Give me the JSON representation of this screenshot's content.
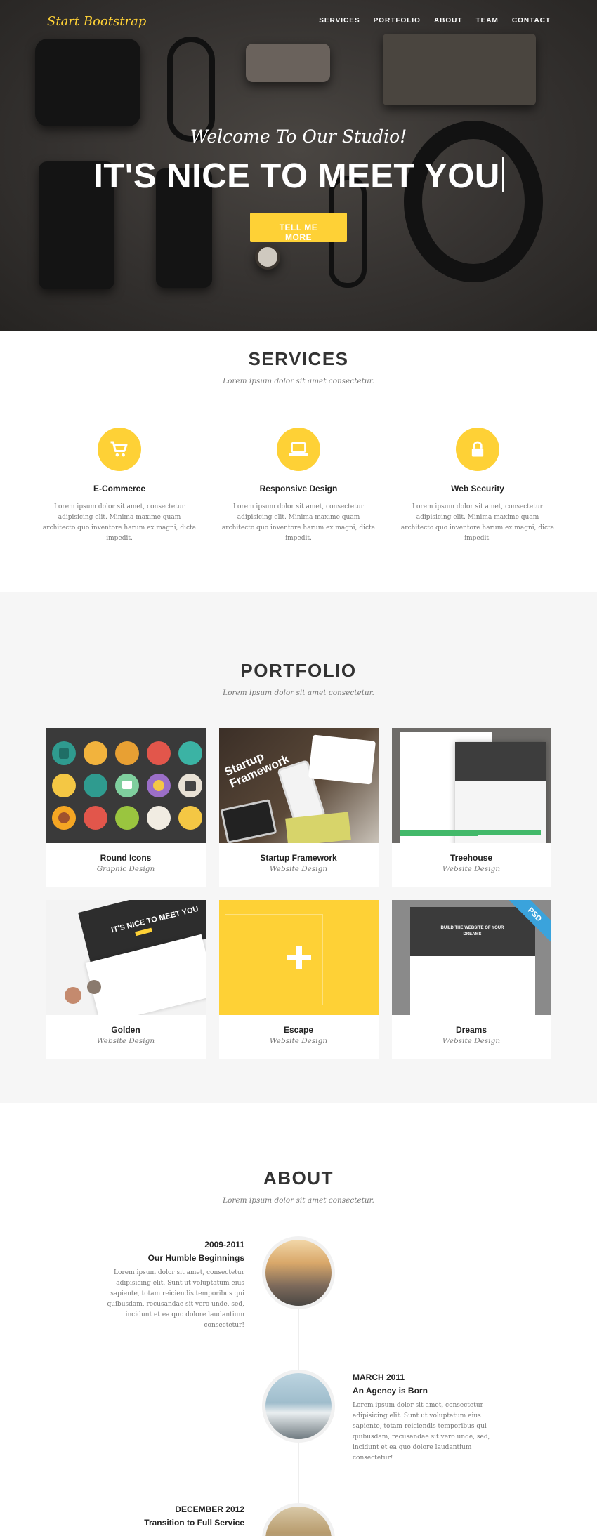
{
  "nav": {
    "brand": "Start Bootstrap",
    "items": [
      "SERVICES",
      "PORTFOLIO",
      "ABOUT",
      "TEAM",
      "CONTACT"
    ]
  },
  "hero": {
    "lead": "Welcome To Our Studio!",
    "heading": "IT'S NICE TO MEET YOU",
    "button": "TELL ME MORE"
  },
  "services": {
    "title": "SERVICES",
    "subtitle": "Lorem ipsum dolor sit amet consectetur.",
    "items": [
      {
        "icon": "shopping-cart-icon",
        "title": "E-Commerce",
        "text": "Lorem ipsum dolor sit amet, consectetur adipisicing elit. Minima maxime quam architecto quo inventore harum ex magni, dicta impedit."
      },
      {
        "icon": "laptop-icon",
        "title": "Responsive Design",
        "text": "Lorem ipsum dolor sit amet, consectetur adipisicing elit. Minima maxime quam architecto quo inventore harum ex magni, dicta impedit."
      },
      {
        "icon": "lock-icon",
        "title": "Web Security",
        "text": "Lorem ipsum dolor sit amet, consectetur adipisicing elit. Minima maxime quam architecto quo inventore harum ex magni, dicta impedit."
      }
    ]
  },
  "portfolio": {
    "title": "PORTFOLIO",
    "subtitle": "Lorem ipsum dolor sit amet consectetur.",
    "items": [
      {
        "title": "Round Icons",
        "category": "Graphic Design"
      },
      {
        "title": "Startup Framework",
        "category": "Website Design",
        "thumb_text": "Startup Framework"
      },
      {
        "title": "Treehouse",
        "category": "Website Design"
      },
      {
        "title": "Golden",
        "category": "Website Design",
        "thumb_text": "IT'S NICE TO MEET YOU"
      },
      {
        "title": "Escape",
        "category": "Website Design"
      },
      {
        "title": "Dreams",
        "category": "Website Design",
        "thumb_text": "BUILD THE WEBSITE OF YOUR DREAMS",
        "badge": "PSD"
      }
    ]
  },
  "about": {
    "title": "ABOUT",
    "subtitle": "Lorem ipsum dolor sit amet consectetur.",
    "timeline": [
      {
        "date": "2009-2011",
        "title": "Our Humble Beginnings",
        "text": "Lorem ipsum dolor sit amet, consectetur adipisicing elit. Sunt ut voluptatum eius sapiente, totam reiciendis temporibus qui quibusdam, recusandae sit vero unde, sed, incidunt et ea quo dolore laudantium consectetur!"
      },
      {
        "date": "MARCH 2011",
        "title": "An Agency is Born",
        "text": "Lorem ipsum dolor sit amet, consectetur adipisicing elit. Sunt ut voluptatum eius sapiente, totam reiciendis temporibus qui quibusdam, recusandae sit vero unde, sed, incidunt et ea quo dolore laudantium consectetur!"
      },
      {
        "date": "DECEMBER 2012",
        "title": "Transition to Full Service"
      }
    ]
  },
  "colors": {
    "accent": "#fed136",
    "dark": "#222222",
    "muted": "#777777",
    "section_gray": "#f6f6f6"
  }
}
